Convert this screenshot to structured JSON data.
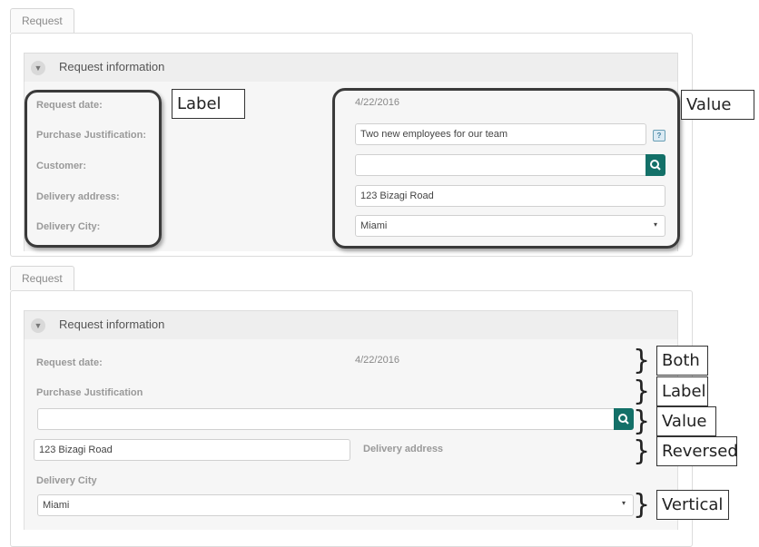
{
  "top": {
    "tab_label": "Request",
    "group_title": "Request information",
    "fields": [
      {
        "label": "Request date:"
      },
      {
        "label": "Purchase Justification:"
      },
      {
        "label": "Customer:"
      },
      {
        "label": "Delivery address:"
      },
      {
        "label": "Delivery City:"
      }
    ],
    "request_date_value": "4/22/2016",
    "justification_value": "Two new employees for our team",
    "customer_value": "",
    "address_value": "123 Bizagi Road",
    "city_value": "Miami",
    "help_icon_text": "?",
    "annotations": {
      "label": "Label",
      "value": "Value"
    }
  },
  "bottom": {
    "tab_label": "Request",
    "group_title": "Request information",
    "request_date_label": "Request date:",
    "request_date_value": "4/22/2016",
    "justification_label": "Purchase Justification",
    "customer_value": "",
    "address_value": "123 Bizagi Road",
    "address_label": "Delivery address",
    "city_label": "Delivery City",
    "city_value": "Miami",
    "annotations": {
      "both": "Both",
      "label": "Label",
      "value": "Value",
      "reversed": "Reversed",
      "vertical": "Vertical"
    }
  },
  "colors": {
    "accent": "#137068",
    "panel_bg": "#f6f6f6",
    "header_bg": "#eeeeee"
  },
  "icons": {
    "collapse": "chevron-down-icon",
    "search": "search-icon",
    "help": "help-icon",
    "dropdown": "caret-down-icon"
  }
}
